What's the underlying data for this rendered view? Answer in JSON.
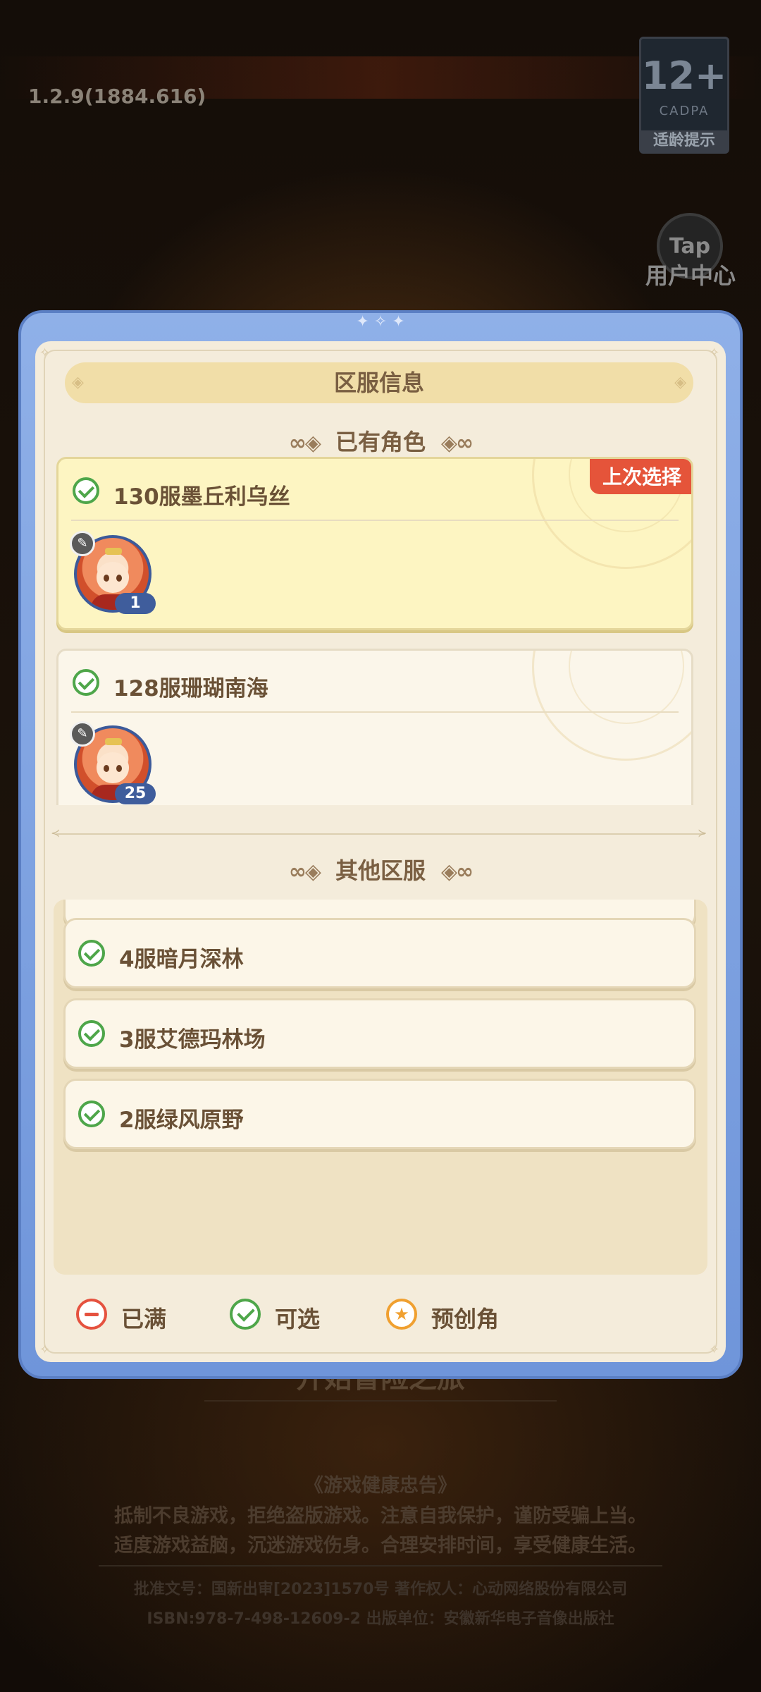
{
  "background": {
    "version": "1.2.9(1884.616)",
    "age_rating": {
      "number": "12+",
      "org": "CADPA",
      "tip": "适龄提示"
    },
    "tap_logo": "Tap",
    "user_center": "用户中心",
    "start_button": "开始冒险之旅",
    "health_notice": {
      "title": "《游戏健康忠告》",
      "line1": "抵制不良游戏，拒绝盗版游戏。注意自我保护，谨防受骗上当。",
      "line2": "适度游戏益脑，沉迷游戏伤身。合理安排时间，享受健康生活。"
    },
    "publish": {
      "line1": "批准文号：国新出审[2023]1570号  著作权人：心动网络股份有限公司",
      "line2": "ISBN:978-7-498-12609-2      出版单位：安徽新华电子音像出版社"
    }
  },
  "dialog": {
    "title": "区服信息",
    "existing_section": "已有角色",
    "other_section": "其他区服",
    "roles": [
      {
        "server": "130服墨丘利乌丝",
        "last_selected_tag": "上次选择",
        "level": "1",
        "status": "available"
      },
      {
        "server": "128服珊瑚南海",
        "level": "25",
        "status": "available"
      }
    ],
    "other_servers": [
      {
        "name": "4服暗月深林",
        "status": "available"
      },
      {
        "name": "3服艾德玛林场",
        "status": "available"
      },
      {
        "name": "2服绿风原野",
        "status": "available"
      }
    ],
    "legend": {
      "full": "已满",
      "available": "可选",
      "pre_create": "预创角"
    }
  },
  "colors": {
    "frame_blue": "#7a9ee0",
    "panel_cream": "#f4ecdb",
    "available_green": "#4ea64a",
    "full_red": "#e5523f",
    "pre_create_orange": "#f0a030",
    "last_tag_red": "#e5543a",
    "selected_yellow": "#fdf5c2"
  }
}
